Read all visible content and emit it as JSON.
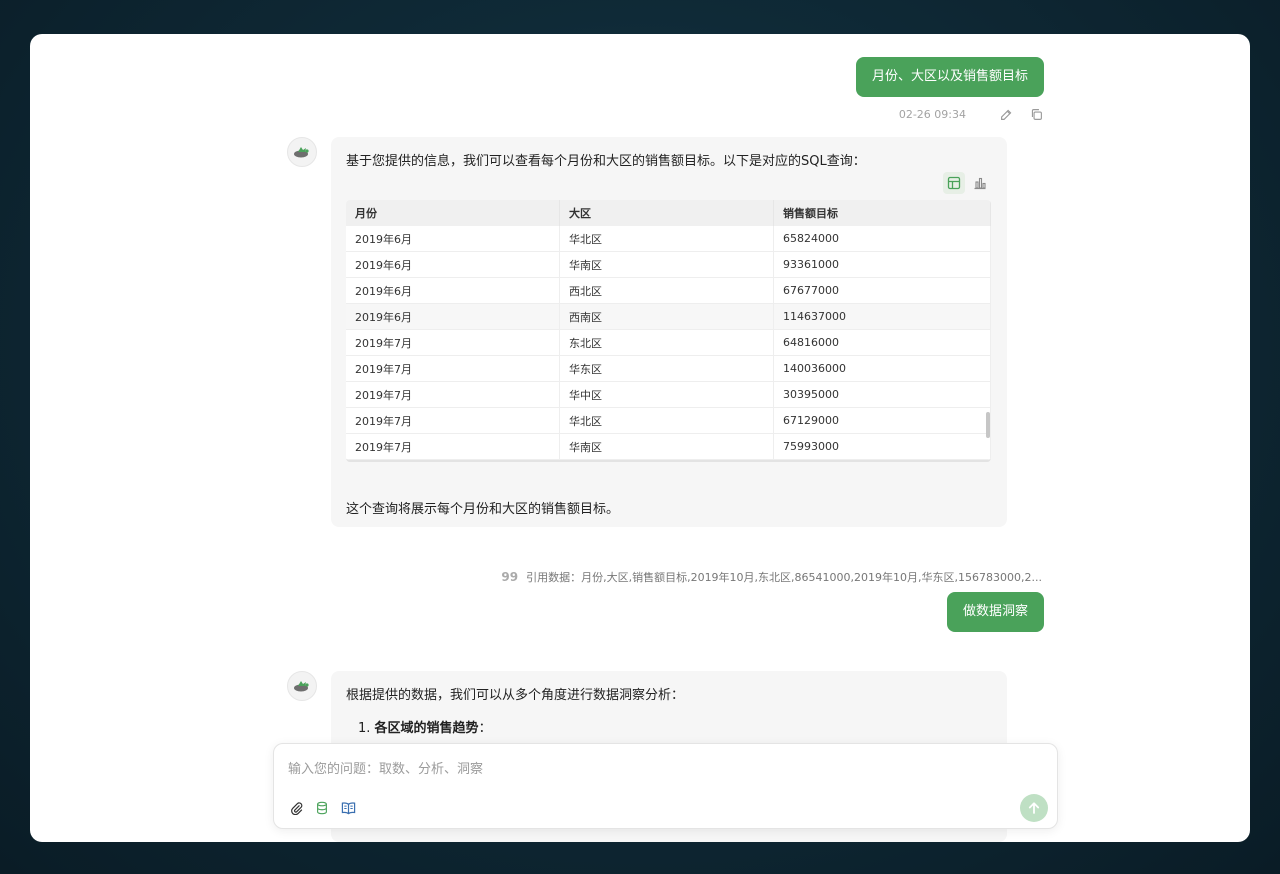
{
  "messages": {
    "user1": {
      "text": "月份、大区以及销售额目标",
      "time": "02-26 09:34"
    },
    "bot1": {
      "intro": "基于您提供的信息，我们可以查看每个月份和大区的销售额目标。以下是对应的SQL查询：",
      "outro": "这个查询将展示每个月份和大区的销售额目标。",
      "table": {
        "headers": [
          "月份",
          "大区",
          "销售额目标"
        ],
        "rows": [
          [
            "2019年6月",
            "华北区",
            "65824000"
          ],
          [
            "2019年6月",
            "华南区",
            "93361000"
          ],
          [
            "2019年6月",
            "西北区",
            "67677000"
          ],
          [
            "2019年6月",
            "西南区",
            "114637000"
          ],
          [
            "2019年7月",
            "东北区",
            "64816000"
          ],
          [
            "2019年7月",
            "华东区",
            "140036000"
          ],
          [
            "2019年7月",
            "华中区",
            "30395000"
          ],
          [
            "2019年7月",
            "华北区",
            "67129000"
          ],
          [
            "2019年7月",
            "华南区",
            "75993000"
          ]
        ]
      }
    },
    "citation": {
      "quote": "99",
      "text": "引用数据：月份,大区,销售额目标,2019年10月,东北区,86541000,2019年10月,华东区,156783000,2..."
    },
    "user2": {
      "text": "做数据洞察"
    },
    "bot2": {
      "intro": "根据提供的数据，我们可以从多个角度进行数据洞察分析：",
      "list_number": "1.",
      "list_title": "各区域的销售趋势",
      "list_suffix": "："
    }
  },
  "composer": {
    "placeholder": "输入您的问题：取数、分析、洞察"
  },
  "colors": {
    "accent": "#4aa25a",
    "send_disabled": "#bfe0c4"
  }
}
